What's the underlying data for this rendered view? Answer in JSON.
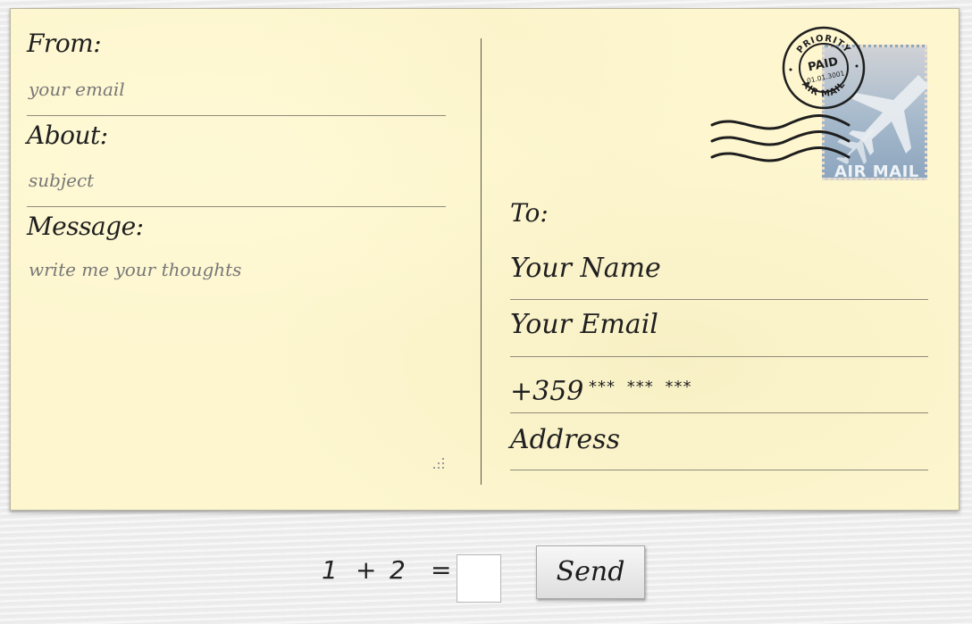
{
  "left": {
    "from_label": "From:",
    "from_placeholder": "your email",
    "about_label": "About:",
    "about_placeholder": "subject",
    "message_label": "Message:",
    "message_placeholder": "write me your thoughts"
  },
  "right": {
    "to_label": "To:",
    "name": "Your Name",
    "email": "Your Email",
    "phone_prefix": "+359",
    "phone_mask": "*** *** ***",
    "address": "Address"
  },
  "stamp": {
    "postmark_top": "PRIORITY",
    "postmark_center": "PAID",
    "postmark_date": "01.01.3001",
    "postmark_bottom": "AIR MAIL",
    "stamp_label": "AIR MAIL"
  },
  "captcha": {
    "a": "1",
    "op": "+",
    "b": "2",
    "eq": "=",
    "answer": ""
  },
  "send_label": "Send"
}
